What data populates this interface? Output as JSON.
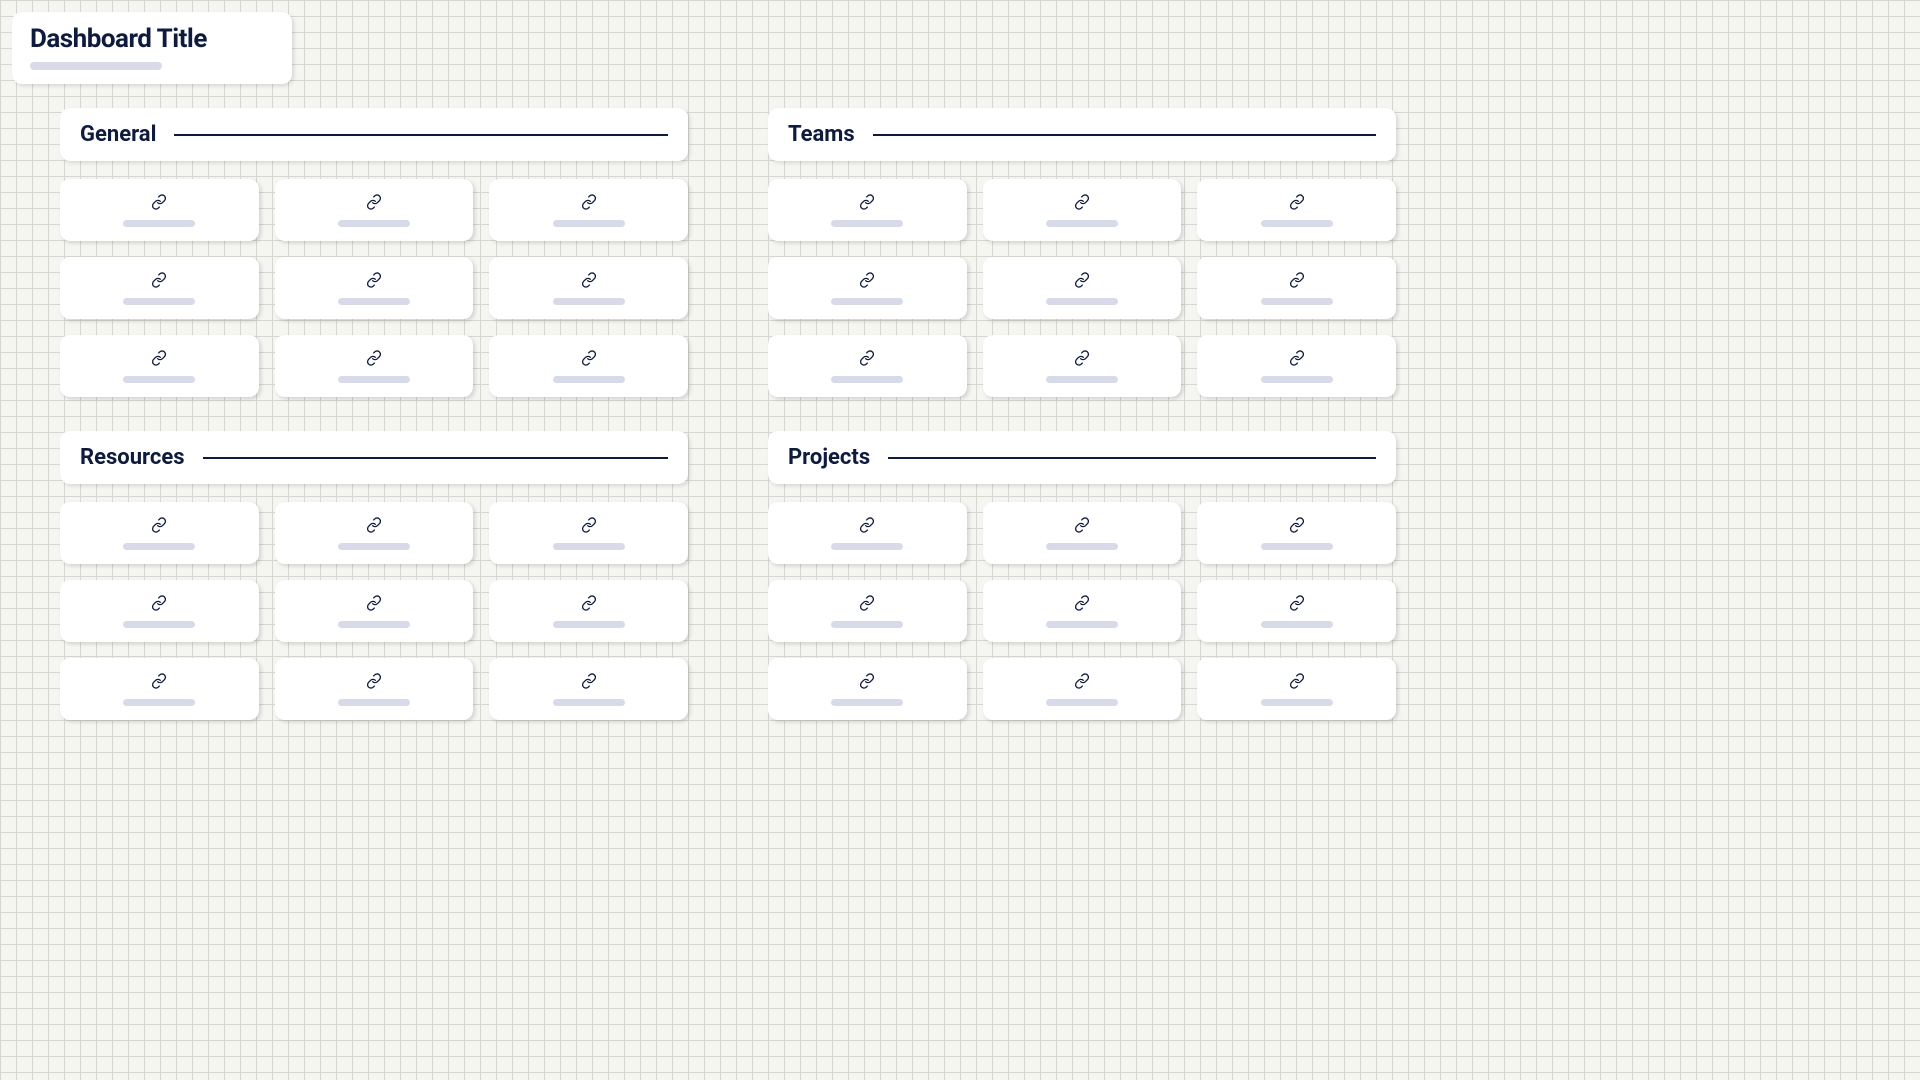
{
  "title": "Dashboard Title",
  "sections": [
    {
      "label": "General",
      "card_count": 9
    },
    {
      "label": "Teams",
      "card_count": 9
    },
    {
      "label": "Resources",
      "card_count": 9
    },
    {
      "label": "Projects",
      "card_count": 9
    }
  ],
  "icons": {
    "link": "link-icon"
  }
}
